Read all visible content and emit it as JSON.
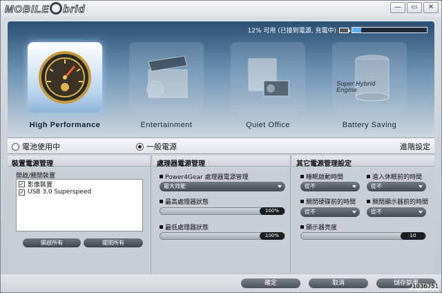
{
  "app": {
    "logo_text_left": "MOBILE",
    "logo_text_right": "brid",
    "window_buttons": {
      "minimize": "—",
      "restore": "▭",
      "close": "✕"
    }
  },
  "battery": {
    "status_text": "12% 可用 (已接到電源, 充電中)",
    "percent": 12
  },
  "modes": [
    {
      "label": "High Performance",
      "icon": "speedometer-icon",
      "active": true
    },
    {
      "label": "Entertainment",
      "icon": "clapperboard-icon",
      "active": false
    },
    {
      "label": "Quiet Office",
      "icon": "projector-icon",
      "active": false
    },
    {
      "label": "Battery Saving",
      "icon": "super-hybrid-engine-icon",
      "active": false,
      "overlay_text": "Super Hybrid Engine"
    }
  ],
  "power_source": {
    "battery_label": "電池使用中",
    "ac_label": "一般電源",
    "selected": "ac",
    "advanced_label": "進階設定"
  },
  "device_power": {
    "title": "裝置電源管理",
    "subtitle": "開啟/關閉裝置",
    "devices": [
      {
        "label": "影像裝置",
        "checked": true
      },
      {
        "label": "USB 3.0 Superspeed",
        "checked": true
      }
    ],
    "enable_all": "開啟所有",
    "disable_all": "關閉所有"
  },
  "cpu_power": {
    "title": "處理器電源管理",
    "power4gear_label": "Power4Gear 處理器電源管理",
    "power4gear_value": "最大效能",
    "max_state_label": "最高處理器狀態",
    "max_state_value": "100%",
    "min_state_label": "最低處理器狀態",
    "min_state_value": "100%"
  },
  "other_power": {
    "title": "其它電源管理設定",
    "screensaver_label": "睡眠啟動時間",
    "screensaver_value": "從不",
    "hibernate_label": "進入休眠前的時間",
    "hibernate_value": "從不",
    "disk_off_label": "關閉硬碟前的時間",
    "disk_off_value": "從不",
    "display_off_label": "關閉顯示器前的時間",
    "display_off_value": "從不",
    "brightness_label": "顯示器亮度",
    "brightness_value": "10"
  },
  "footer": {
    "ok": "確定",
    "cancel": "取消",
    "restore_defaults": "儲存變更"
  },
  "watermark": "#1036751"
}
